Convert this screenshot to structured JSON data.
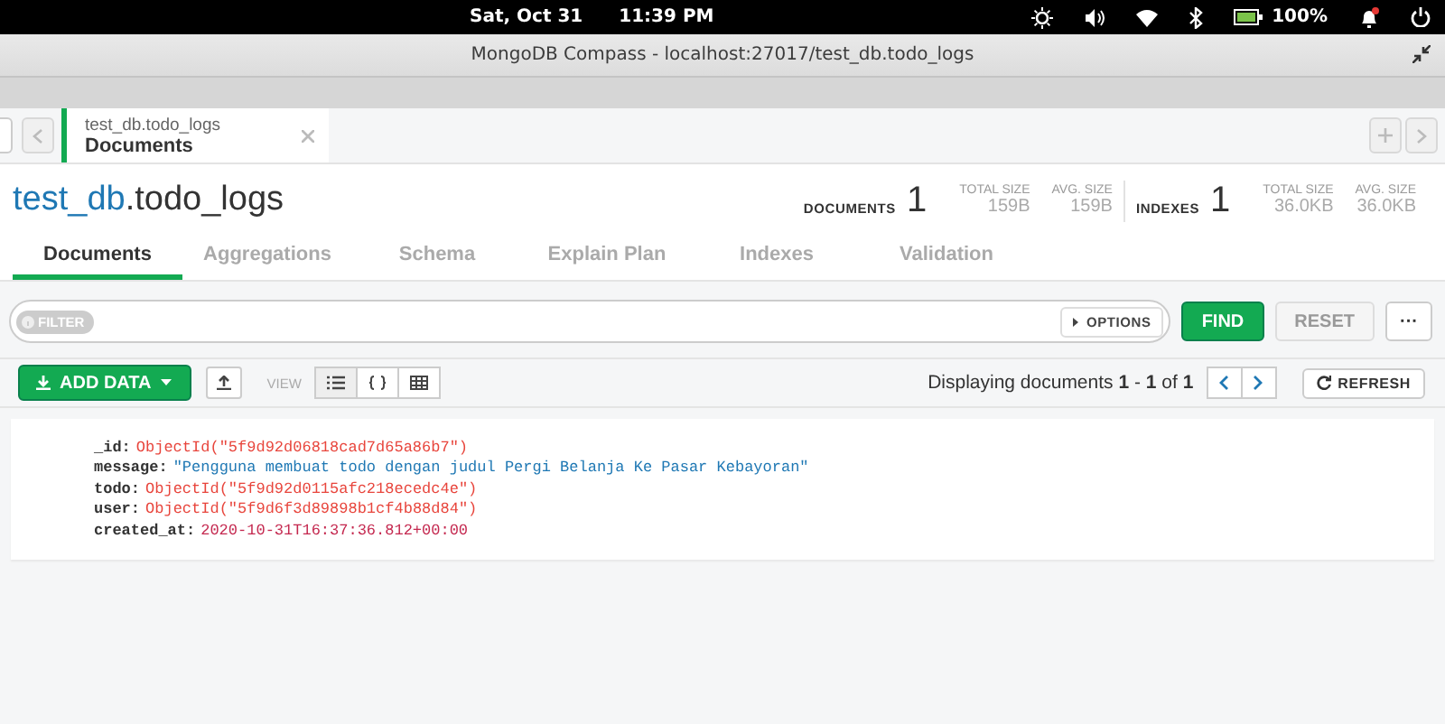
{
  "system_bar": {
    "date": "Sat, Oct 31",
    "time": "11:39 PM",
    "battery": "100%"
  },
  "window": {
    "title": "MongoDB Compass - localhost:27017/test_db.todo_logs"
  },
  "workspace_tabs": [
    {
      "namespace": "test_db.todo_logs",
      "view": "Documents",
      "selected": true
    }
  ],
  "collection": {
    "database": "test_db",
    "name": ".todo_logs",
    "stats": [
      {
        "label": "DOCUMENTS",
        "value": "1",
        "sizes": [
          {
            "label": "TOTAL SIZE",
            "value": "159B"
          },
          {
            "label": "AVG. SIZE",
            "value": "159B"
          }
        ]
      },
      {
        "label": "INDEXES",
        "value": "1",
        "sizes": [
          {
            "label": "TOTAL SIZE",
            "value": "36.0KB"
          },
          {
            "label": "AVG. SIZE",
            "value": "36.0KB"
          }
        ]
      }
    ]
  },
  "tabs": [
    {
      "label": "Documents",
      "selected": true
    },
    {
      "label": "Aggregations",
      "selected": false
    },
    {
      "label": "Schema",
      "selected": false
    },
    {
      "label": "Explain Plan",
      "selected": false
    },
    {
      "label": "Indexes",
      "selected": false
    },
    {
      "label": "Validation",
      "selected": false
    }
  ],
  "query_bar": {
    "filter_label": "FILTER",
    "options": "OPTIONS",
    "find": "FIND",
    "reset": "RESET",
    "reset_disabled": true,
    "more": "···"
  },
  "toolbar": {
    "add_data": "ADD DATA",
    "view_label": "VIEW",
    "views": [
      {
        "kind": "list",
        "selected": true
      },
      {
        "kind": "json",
        "selected": false
      },
      {
        "kind": "table",
        "selected": false
      }
    ],
    "display": "Displaying documents **1** - **1** of **1**",
    "refresh": "REFRESH"
  },
  "documents": [
    {
      "fields": [
        {
          "key": "_id:",
          "value": "ObjectId(\"5f9d92d06818cad7d65a86b7\")",
          "kind": "objectid"
        },
        {
          "key": "message:",
          "value": "\"Pengguna membuat todo dengan judul Pergi Belanja Ke Pasar Kebayoran\"",
          "kind": "string"
        },
        {
          "key": "todo:",
          "value": "ObjectId(\"5f9d92d0115afc218ecedc4e\")",
          "kind": "objectid"
        },
        {
          "key": "user:",
          "value": "ObjectId(\"5f9d6f3d89898b1cf4b88d84\")",
          "kind": "objectid"
        },
        {
          "key": "created_at:",
          "value": "2020-10-31T16:37:36.812+00:00",
          "kind": "date"
        }
      ]
    }
  ]
}
